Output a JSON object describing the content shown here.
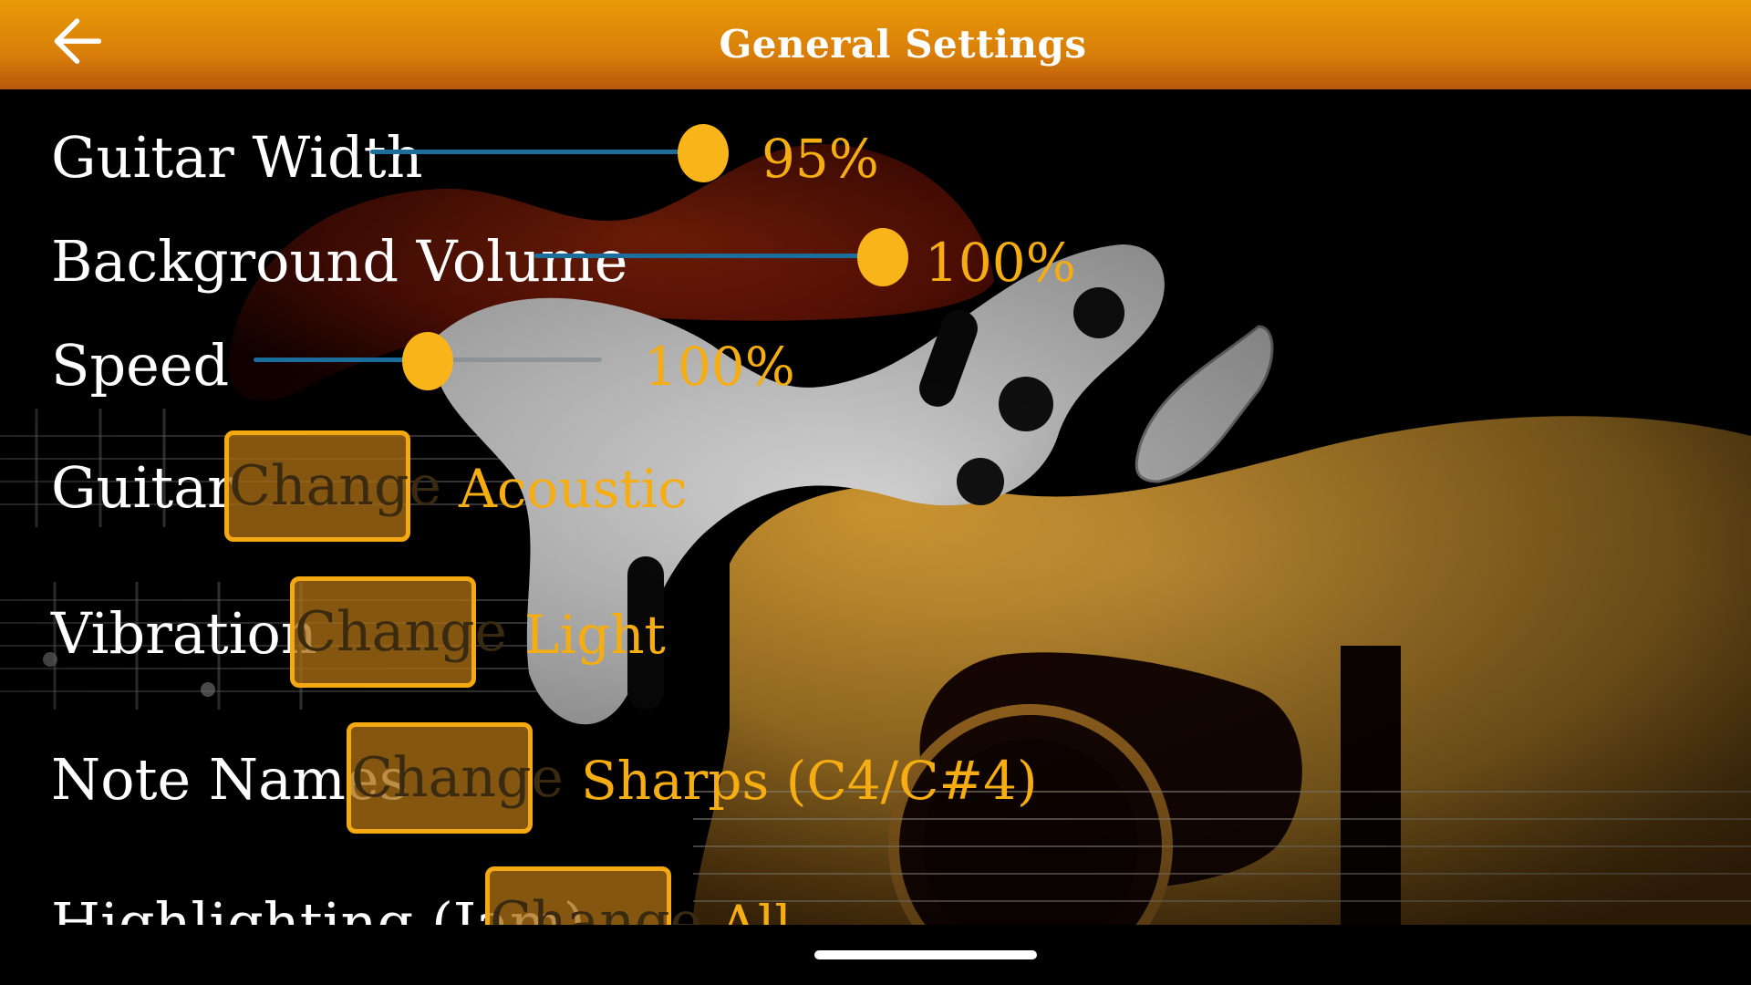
{
  "header": {
    "title": "General Settings",
    "back_icon": "arrow-left-icon"
  },
  "colors": {
    "header_top": "#e89a08",
    "header_bottom": "#b9580b",
    "accent": "#f5ad12",
    "slider_fill": "#1b6e9c"
  },
  "settings": {
    "guitar_width": {
      "label": "Guitar Width",
      "value_text": "95%",
      "level": 0.95
    },
    "background_volume": {
      "label": "Background Volume",
      "value_text": "100%",
      "level": 1.0
    },
    "speed": {
      "label": "Speed",
      "value_text": "100%",
      "level": 0.5
    },
    "guitar": {
      "label": "Guitar",
      "button": "Change",
      "value": "Acoustic"
    },
    "vibration": {
      "label": "Vibration",
      "button": "Change",
      "value": "Light"
    },
    "note_names": {
      "label": "Note Names",
      "button": "Change",
      "value": "Sharps (C4/C#4)"
    },
    "highlighting": {
      "label": "Highlighting (Jam)",
      "button": "Change",
      "value": "All"
    }
  },
  "background": {
    "image": "guitars-background"
  }
}
